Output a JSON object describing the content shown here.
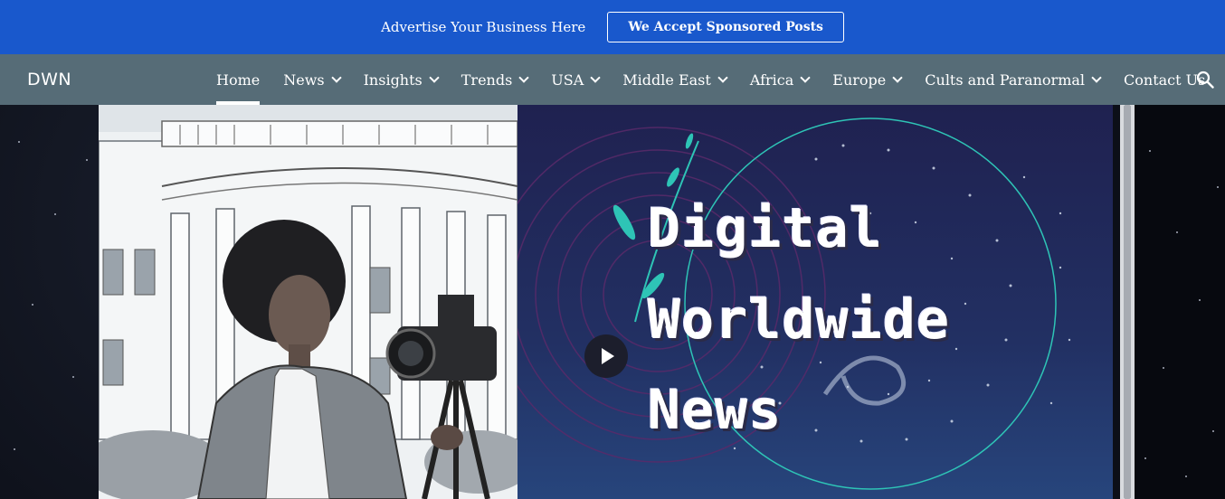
{
  "promo": {
    "text": "Advertise Your Business Here",
    "button": "We Accept Sponsored Posts"
  },
  "nav": {
    "brand": "DWN",
    "items": [
      {
        "label": "Home",
        "active": true,
        "dropdown": false
      },
      {
        "label": "News",
        "dropdown": true
      },
      {
        "label": "Insights",
        "dropdown": true
      },
      {
        "label": "Trends",
        "dropdown": true
      },
      {
        "label": "USA",
        "dropdown": true
      },
      {
        "label": "Middle East",
        "dropdown": true
      },
      {
        "label": "Africa",
        "dropdown": true
      },
      {
        "label": "Europe",
        "dropdown": true
      },
      {
        "label": "Cults and Paranormal",
        "dropdown": true
      },
      {
        "label": "Contact Us",
        "dropdown": false
      }
    ],
    "search_icon": "search-icon"
  },
  "hero": {
    "title_lines": [
      "Digital",
      "Worldwide",
      "News"
    ],
    "play_icon": "play-icon"
  },
  "colors": {
    "promo_bg": "#1958cc",
    "nav_bg": "#566c77",
    "accent_teal": "#2ec4b6"
  }
}
